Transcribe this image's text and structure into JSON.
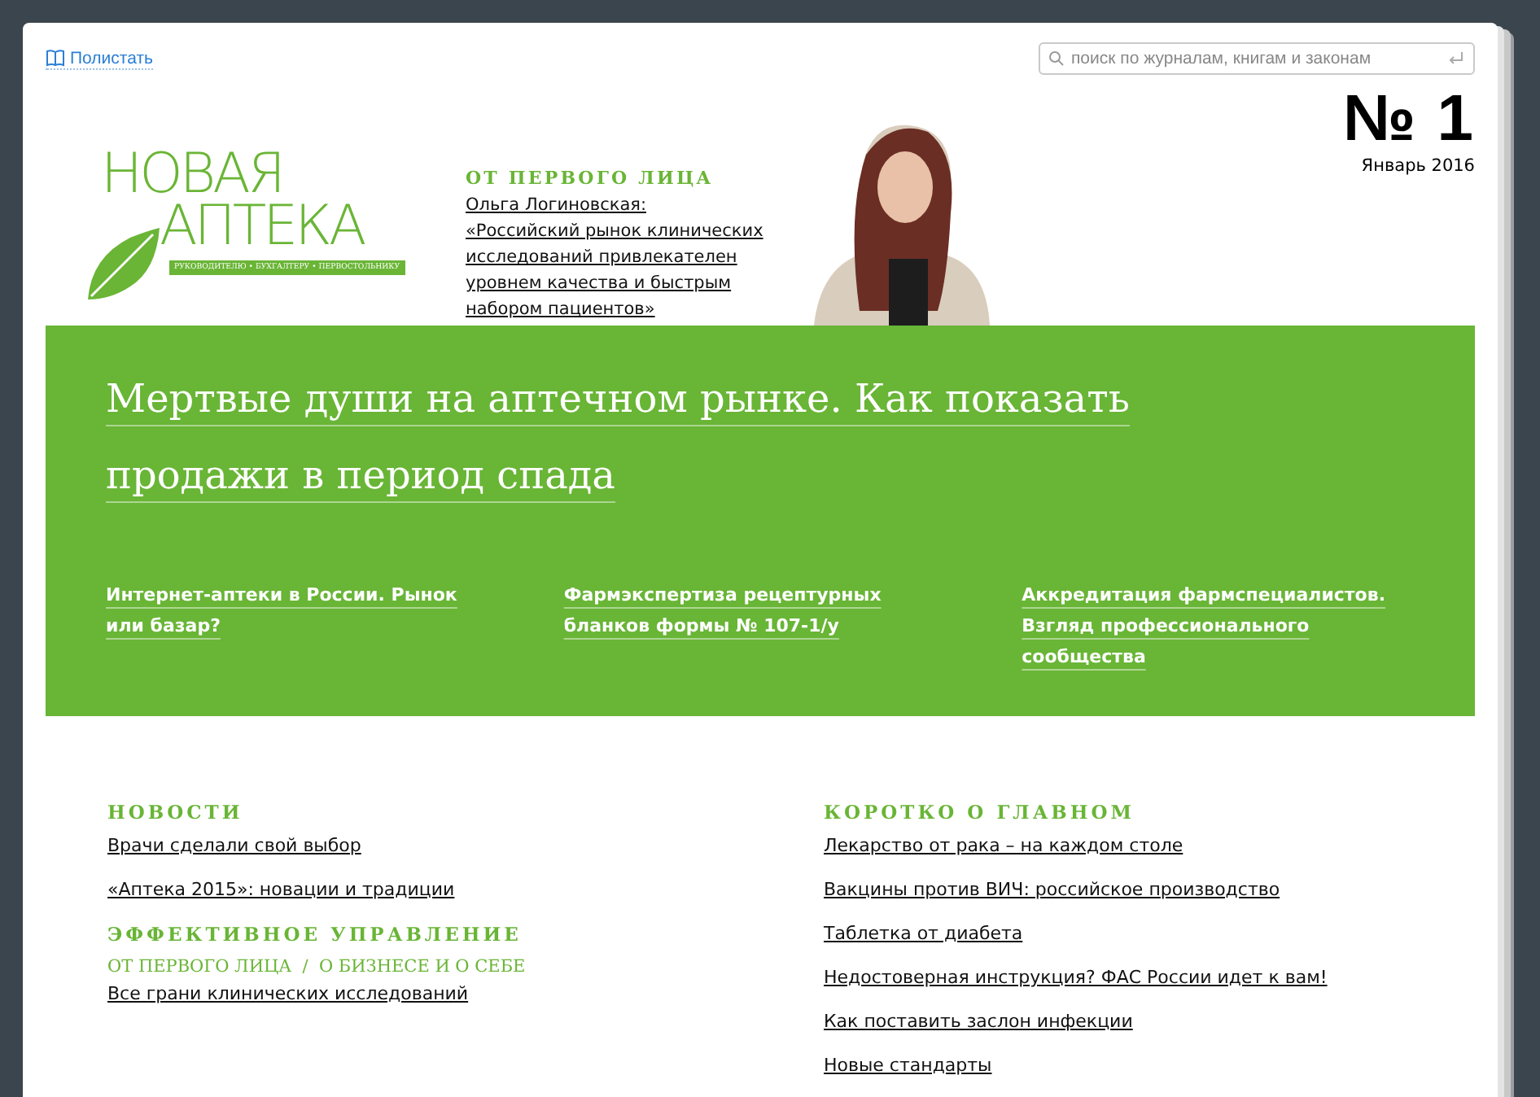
{
  "toolbar": {
    "flip_link": "Полистать",
    "search": {
      "placeholder": "поиск по журналам, книгам и законам"
    }
  },
  "masthead": {
    "logo": {
      "line1": "НОВАЯ",
      "line2": "АПТЕКА",
      "tagline": "РУКОВОДИТЕЛЮ • БУХГАЛТЕРУ • ПЕРВОСТОЛЬНИКУ"
    },
    "feature": {
      "rubric": "ОТ ПЕРВОГО ЛИЦА",
      "author": "Ольга Логиновская:",
      "quote": "«Российский рынок клинических исследований привлекателен уровнем качества и быстрым набором пациентов»"
    },
    "issue": {
      "number": "№ 1",
      "date": "Январь 2016"
    }
  },
  "lead": {
    "headline": "Мертвые души на аптечном рынке. Как показать продажи в период спада",
    "articles": [
      "Интернет-аптеки в России. Рынок или базар?",
      "Фармэкспертиза рецептурных бланков формы № 107-1/у",
      "Аккредитация фармспециалистов. Взгляд профессионального сообщества"
    ]
  },
  "columns": [
    [
      {
        "title": "НОВОСТИ",
        "links": [
          "Врачи сделали свой выбор",
          "«Аптека 2015»: новации и традиции"
        ]
      },
      {
        "title": "ЭФФЕКТИВНОЕ УПРАВЛЕНИЕ",
        "rubric": "ОТ ПЕРВОГО ЛИЦА  /  О БИЗНЕСЕ И О СЕБЕ",
        "links": [
          "Все грани клинических исследований"
        ]
      }
    ],
    [
      {
        "title": "КОРОТКО О ГЛАВНОМ",
        "links": [
          "Лекарство от рака – на каждом столе",
          "Вакцины против ВИЧ: российское производство",
          "Таблетка от диабета",
          "Недостоверная инструкция? ФАС России идет к вам!",
          "Как поставить заслон инфекции",
          "Новые стандарты"
        ]
      }
    ]
  ]
}
